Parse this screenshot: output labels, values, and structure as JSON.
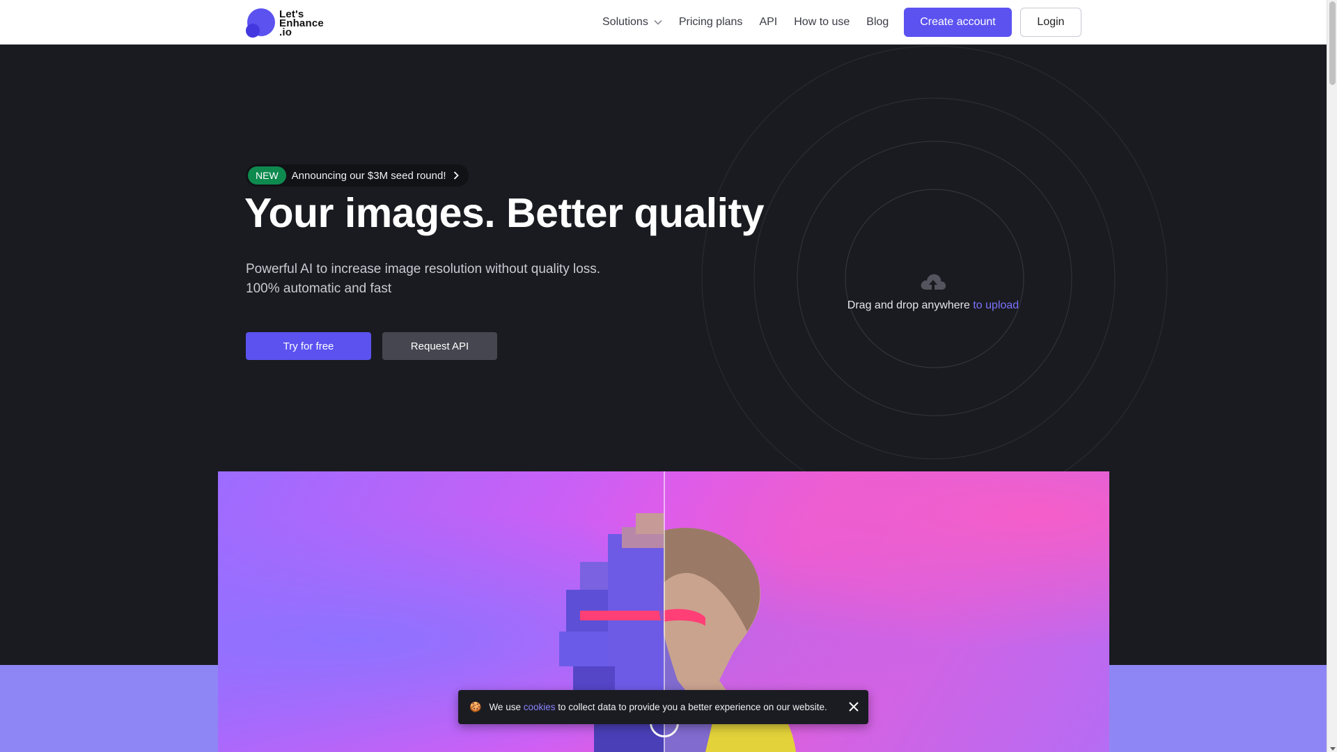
{
  "logo": {
    "line1": "Let's",
    "line2": "Enhance",
    "line3": ".io"
  },
  "nav": {
    "items": [
      {
        "label": "Solutions",
        "has_dropdown": true
      },
      {
        "label": "Pricing plans"
      },
      {
        "label": "API"
      },
      {
        "label": "How to use"
      },
      {
        "label": "Blog"
      }
    ],
    "create_account": "Create account",
    "login": "Login"
  },
  "hero": {
    "badge_new": "NEW",
    "badge_text": "Announcing our $3M seed round!",
    "headline": "Your images. Better quality",
    "sub_line1": "Powerful AI to increase image resolution without quality loss.",
    "sub_line2": "100% automatic and fast",
    "try_button": "Try for free",
    "api_button": "Request API"
  },
  "upload": {
    "icon": "cloud-upload-icon",
    "text": "Drag and drop anywhere",
    "link": "to upload"
  },
  "cookie": {
    "icon": "cookie-icon",
    "before": "We use",
    "link": "cookies",
    "after": "to collect data to provide you a better experience on our website."
  },
  "colors": {
    "accent": "#5b52f0",
    "hero_bg": "#1a1b20",
    "badge_green": "#0e8a4f",
    "link": "#7b73ff"
  }
}
